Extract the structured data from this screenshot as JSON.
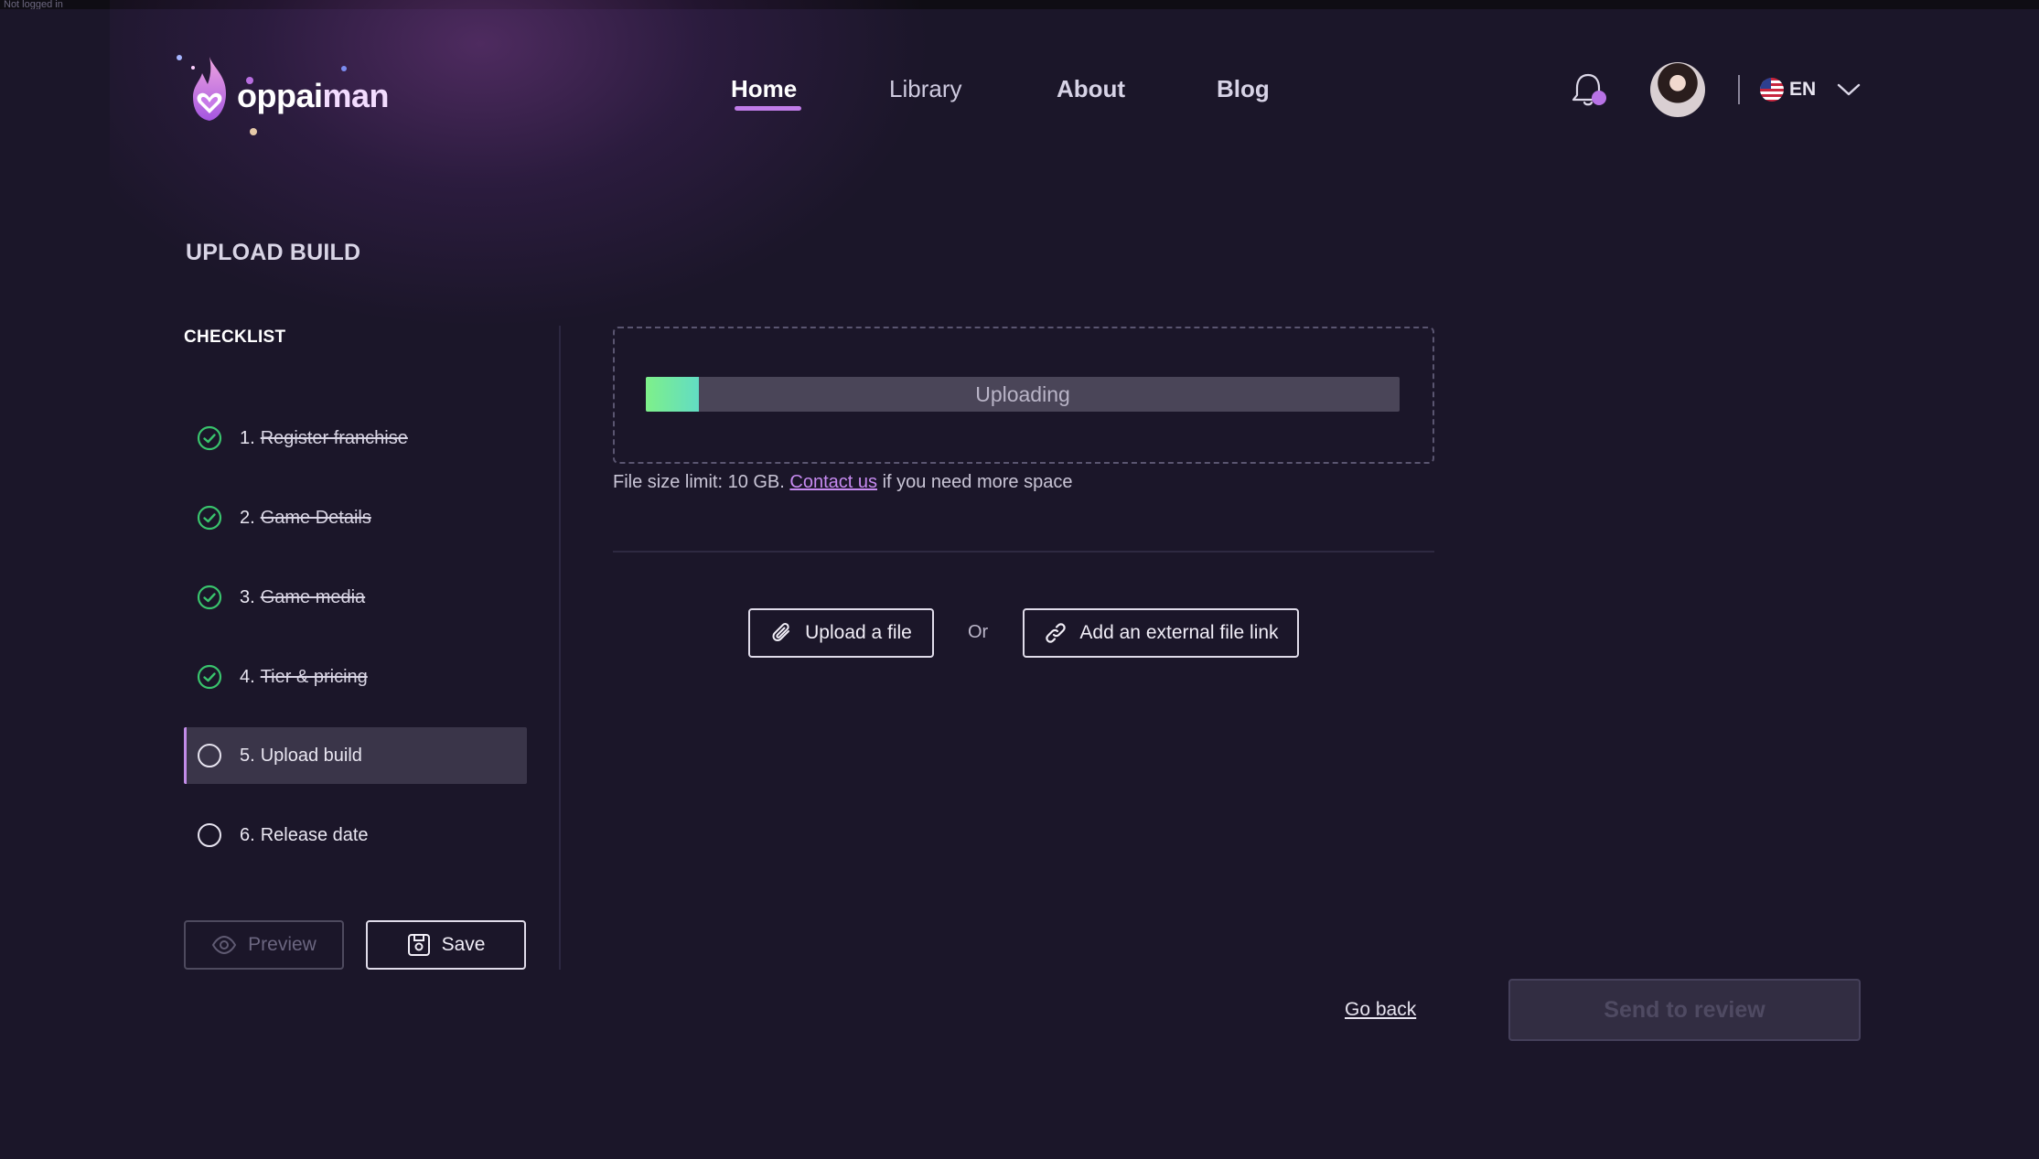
{
  "system_strip": {
    "text": "Not logged in"
  },
  "brand": {
    "name_part1": "oppai",
    "name_part2": "man"
  },
  "nav": {
    "items": [
      {
        "label": "Home",
        "active": true
      },
      {
        "label": "Library",
        "active": false
      },
      {
        "label": "About",
        "active": false
      },
      {
        "label": "Blog",
        "active": false
      }
    ]
  },
  "header": {
    "icons": {
      "notifications": "bell-icon",
      "language": "chevron-down-icon"
    },
    "language": "EN"
  },
  "page": {
    "title": "UPLOAD BUILD"
  },
  "checklist": {
    "title": "CHECKLIST",
    "steps": [
      {
        "num": "1.",
        "label": "Register franchise",
        "done": true
      },
      {
        "num": "2.",
        "label": "Game Details",
        "done": true
      },
      {
        "num": "3.",
        "label": "Game media",
        "done": true
      },
      {
        "num": "4.",
        "label": "Tier & pricing",
        "done": true
      },
      {
        "num": "5.",
        "label": "Upload build",
        "done": false,
        "active": true
      },
      {
        "num": "6.",
        "label": "Release date",
        "done": false
      }
    ],
    "preview_label": "Preview",
    "save_label": "Save"
  },
  "upload": {
    "status": "Uploading",
    "progress_percent": 7,
    "size_note_prefix": "File size limit: 10 GB.",
    "contact_link": "Contact us",
    "size_note_suffix": "if you need more space",
    "upload_file_label": "Upload a file",
    "or_label": "Or",
    "external_link_label": "Add an external file link"
  },
  "footer": {
    "go_back_label": "Go back",
    "send_review_label": "Send to review"
  },
  "colors": {
    "background": "#1b1629",
    "accent": "#c07ce8",
    "check_green": "#39c46d",
    "progress_start": "#7ef08a",
    "progress_end": "#62dcc3"
  }
}
